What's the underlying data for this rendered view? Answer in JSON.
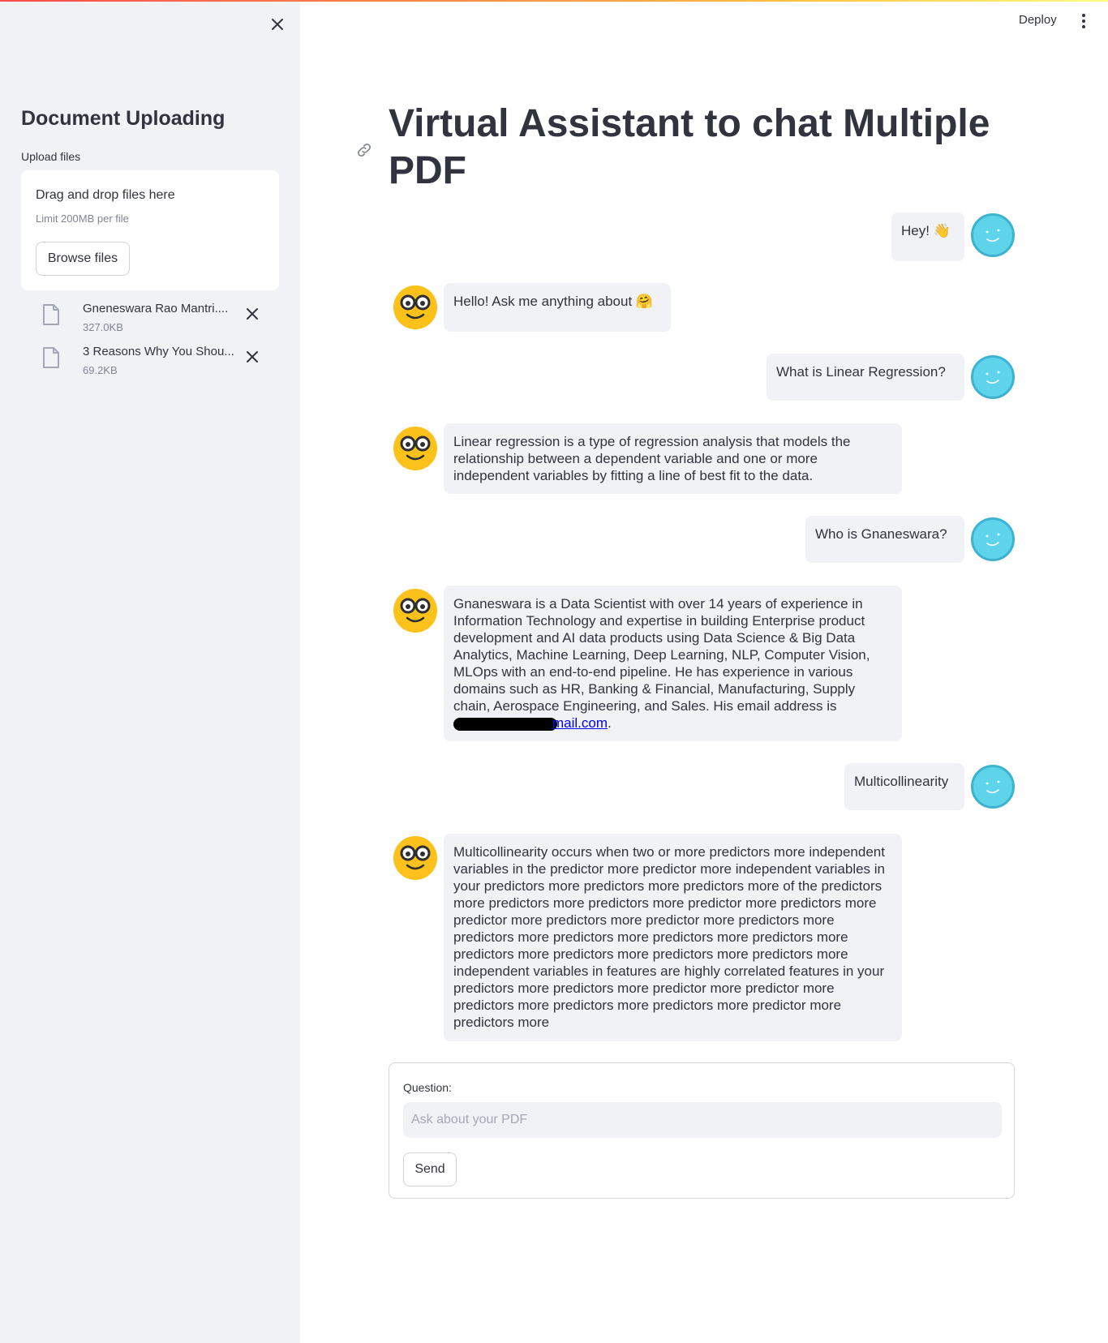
{
  "header": {
    "deploy_label": "Deploy"
  },
  "sidebar": {
    "heading": "Document Uploading",
    "upload_label": "Upload files",
    "dropzone": {
      "title": "Drag and drop files here",
      "limit": "Limit 200MB per file",
      "browse_label": "Browse files"
    },
    "files": [
      {
        "name": "Gneneswara Rao Mantri....",
        "size": "327.0KB"
      },
      {
        "name": "3 Reasons Why You Shou...",
        "size": "69.2KB"
      }
    ]
  },
  "main": {
    "title": "Virtual Assistant to chat Multiple PDF",
    "messages": [
      {
        "role": "user",
        "text": "Hey! 👋"
      },
      {
        "role": "assistant",
        "text": "Hello! Ask me anything about 🤗"
      },
      {
        "role": "user",
        "text": "What is Linear Regression?"
      },
      {
        "role": "assistant",
        "text": "Linear regression is a type of regression analysis that models the relationship between a dependent variable and one or more independent variables by fitting a line of best fit to the data."
      },
      {
        "role": "user",
        "text": "Who is Gnaneswara?"
      },
      {
        "role": "assistant",
        "text": "Gnaneswara is a Data Scientist with over 14 years of experience in Information Technology and expertise in building Enterprise product development and AI data products using Data Science & Big Data Analytics, Machine Learning, Deep Learning, NLP, Computer Vision, MLOps with an end-to-end pipeline. He has experience in various domains such as HR, Banking & Financial, Manufacturing, Supply chain, Aerospace Engineering, and Sales. His email address is",
        "email_visible": "mail.com"
      },
      {
        "role": "user",
        "text": "Multicollinearity"
      },
      {
        "role": "assistant",
        "text": "Multicollinearity occurs when two or more predictors more independent variables in the predictor more predictor more independent variables in your predictors more predictors more predictors more of the predictors more predictors more predictors more predictor more predictors more predictor more predictors more predictor more predictors more predictors more predictors more predictors more predictors more predictors more predictors more predictors more predictors more independent variables in features are highly correlated features in your predictors more predictors more predictor more predictor more predictors more predictors more predictors more predictor more predictors more"
      }
    ]
  },
  "form": {
    "question_label": "Question:",
    "placeholder": "Ask about your PDF",
    "send_label": "Send"
  },
  "colors": {
    "sidebar_bg": "#f0f2f6",
    "bubble_bg": "#f0f2f6",
    "assistant_avatar": "#fcc21b",
    "user_avatar": "#5ed3ea",
    "link": "#0000ee"
  }
}
